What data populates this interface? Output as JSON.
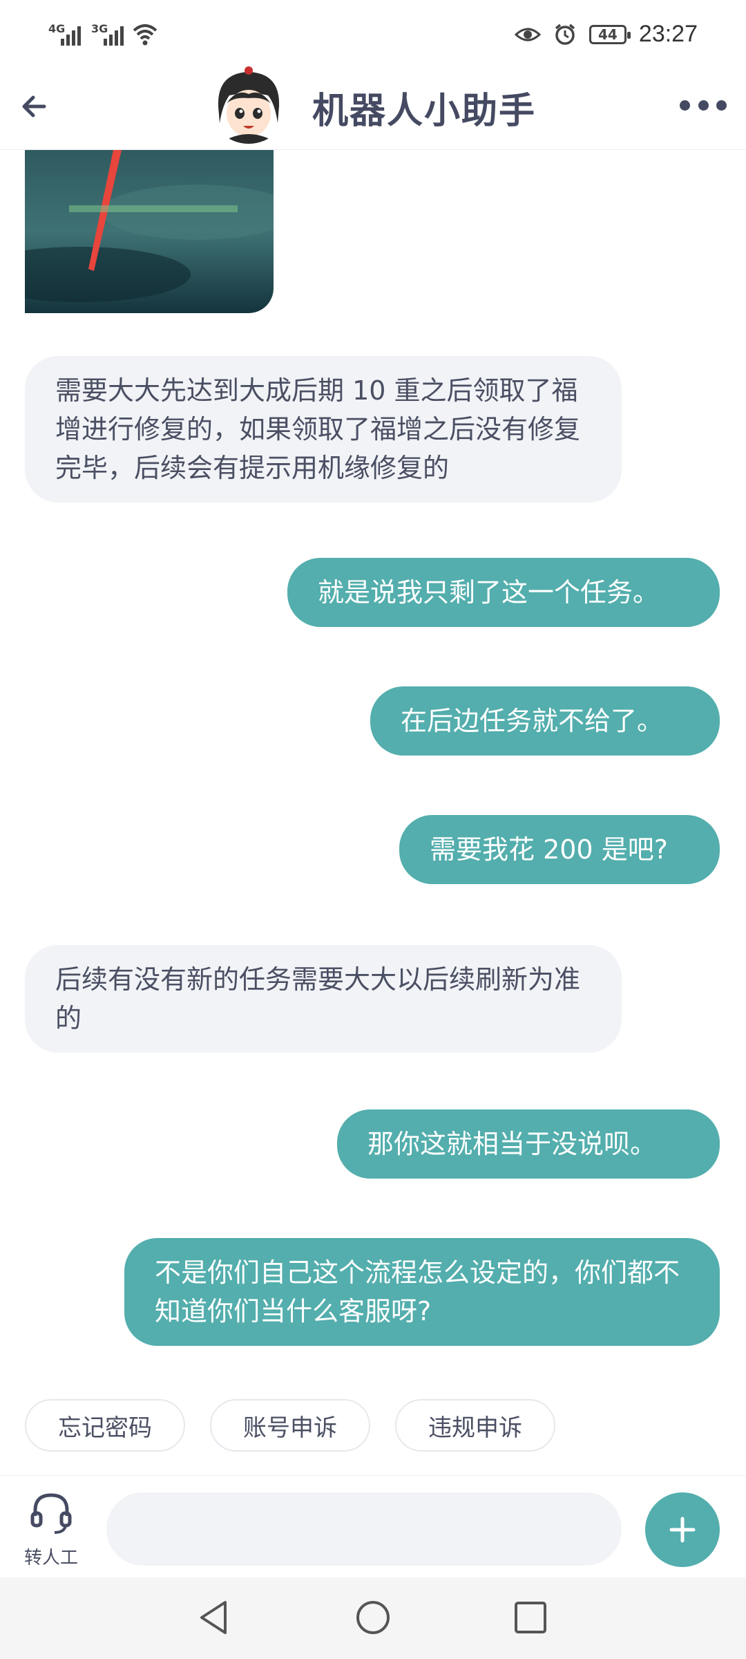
{
  "status_bar": {
    "signal1_label": "4G",
    "signal2_label": "3G",
    "battery": "44",
    "time": "23:27"
  },
  "header": {
    "title": "机器人小助手"
  },
  "messages": [
    {
      "role": "bot",
      "text": "需要大大先达到大成后期 10 重之后领取了福增进行修复的，如果领取了福增之后没有修复完毕，后续会有提示用机缘修复的"
    },
    {
      "role": "user",
      "text": "就是说我只剩了这一个任务。"
    },
    {
      "role": "user",
      "text": "在后边任务就不给了。"
    },
    {
      "role": "user",
      "text": "需要我花 200 是吧?"
    },
    {
      "role": "bot",
      "text": "后续有没有新的任务需要大大以后续刷新为准的"
    },
    {
      "role": "user",
      "text": "那你这就相当于没说呗。"
    },
    {
      "role": "user",
      "text": "不是你们自己这个流程怎么设定的，你们都不知道你们当什么客服呀?"
    }
  ],
  "quick_replies": [
    "忘记密码",
    "账号申诉",
    "违规申诉"
  ],
  "input_bar": {
    "agent_label": "转人工",
    "placeholder": ""
  },
  "colors": {
    "accent": "#53aead",
    "bot_bubble": "#f1f3f6",
    "text": "#4a4f63"
  },
  "icons": [
    "back-arrow-icon",
    "more-icon",
    "headset-icon",
    "plus-icon",
    "eye-icon",
    "alarm-icon",
    "wifi-icon"
  ]
}
